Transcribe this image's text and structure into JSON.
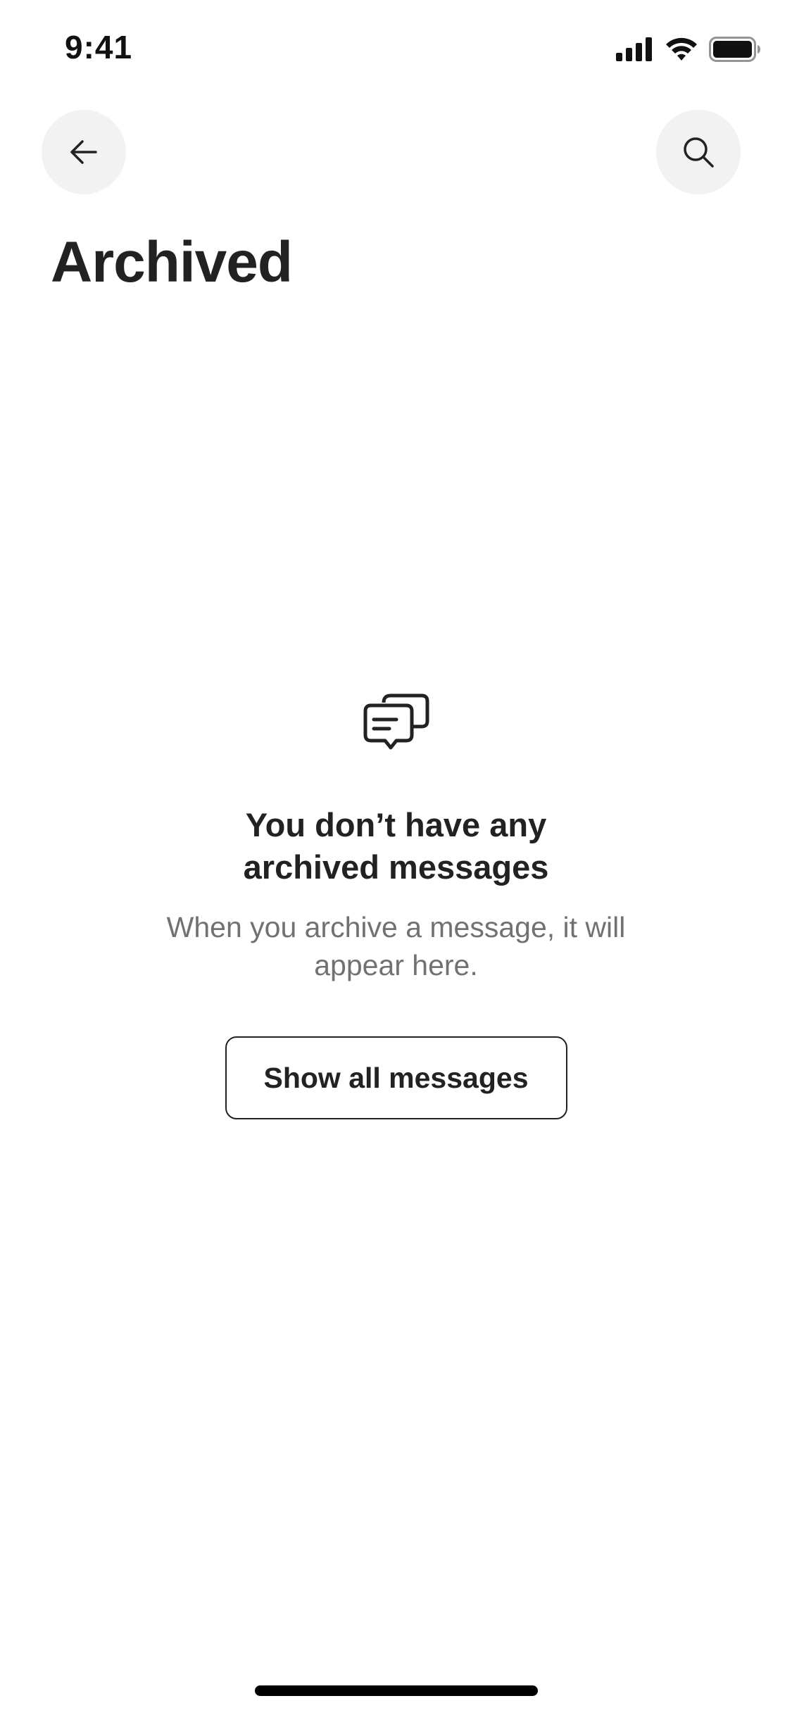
{
  "status_bar": {
    "time": "9:41",
    "icons": [
      "cellular-signal-icon",
      "wifi-icon",
      "battery-icon"
    ]
  },
  "header": {
    "back_icon": "arrow-left-icon",
    "search_icon": "search-icon",
    "title": "Archived"
  },
  "empty_state": {
    "icon": "chat-bubbles-icon",
    "heading": "You don’t have any archived messages",
    "subtext": "When you archive a message, it will appear here.",
    "button_label": "Show all messages"
  },
  "colors": {
    "text_primary": "#222222",
    "text_secondary": "#717171",
    "button_bg": "#f2f2f2",
    "background": "#ffffff"
  }
}
